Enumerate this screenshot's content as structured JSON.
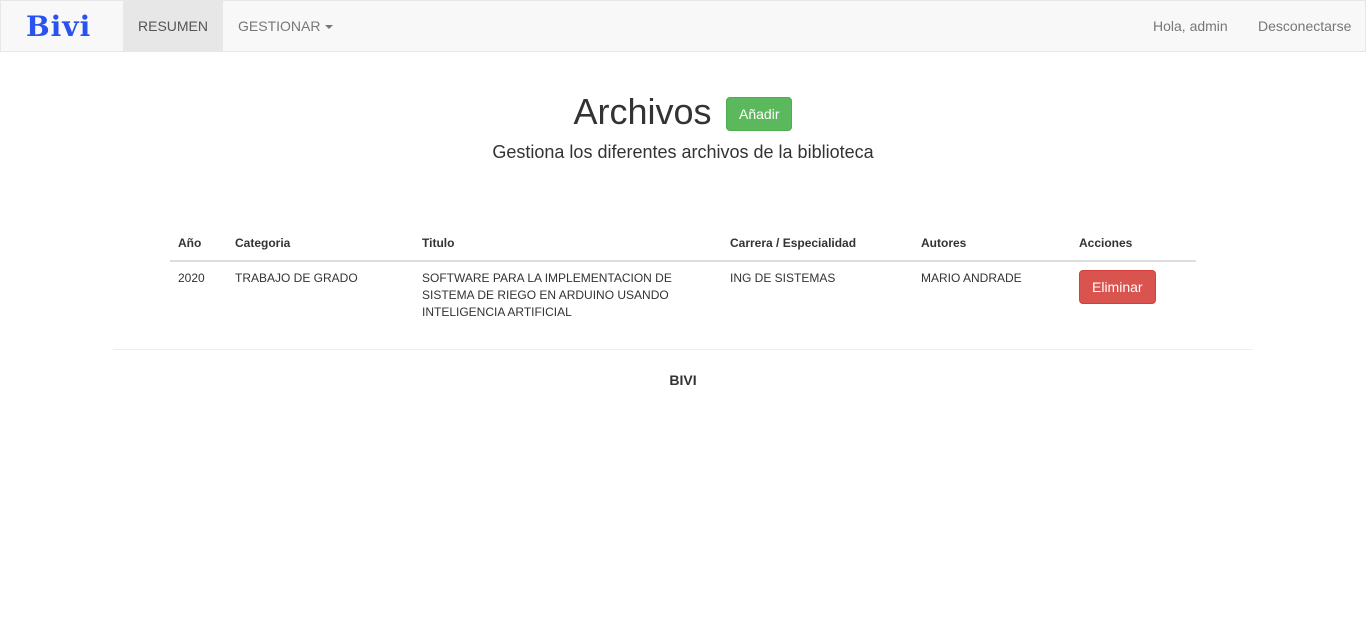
{
  "navbar": {
    "brand": "Bivi",
    "items": [
      {
        "label": "RESUMEN",
        "active": true
      },
      {
        "label": "GESTIONAR",
        "dropdown": true
      }
    ],
    "greeting": "Hola, admin",
    "logout": "Desconectarse"
  },
  "header": {
    "title": "Archivos",
    "add_button": "Añadir",
    "subtitle": "Gestiona los diferentes archivos de la biblioteca"
  },
  "table": {
    "columns": [
      "Año",
      "Categoria",
      "Titulo",
      "Carrera / Especialidad",
      "Autores",
      "Acciones"
    ],
    "rows": [
      {
        "year": "2020",
        "category": "TRABAJO DE GRADO",
        "title": "SOFTWARE PARA LA IMPLEMENTACION DE SISTEMA DE RIEGO EN ARDUINO USANDO INTELIGENCIA ARTIFICIAL",
        "career": "ING DE SISTEMAS",
        "authors": "MARIO ANDRADE",
        "action": "Eliminar"
      }
    ]
  },
  "footer": {
    "text": "BIVI"
  },
  "colors": {
    "brand": "#2a52f0",
    "success": "#5cb85c",
    "danger": "#d9534f"
  }
}
